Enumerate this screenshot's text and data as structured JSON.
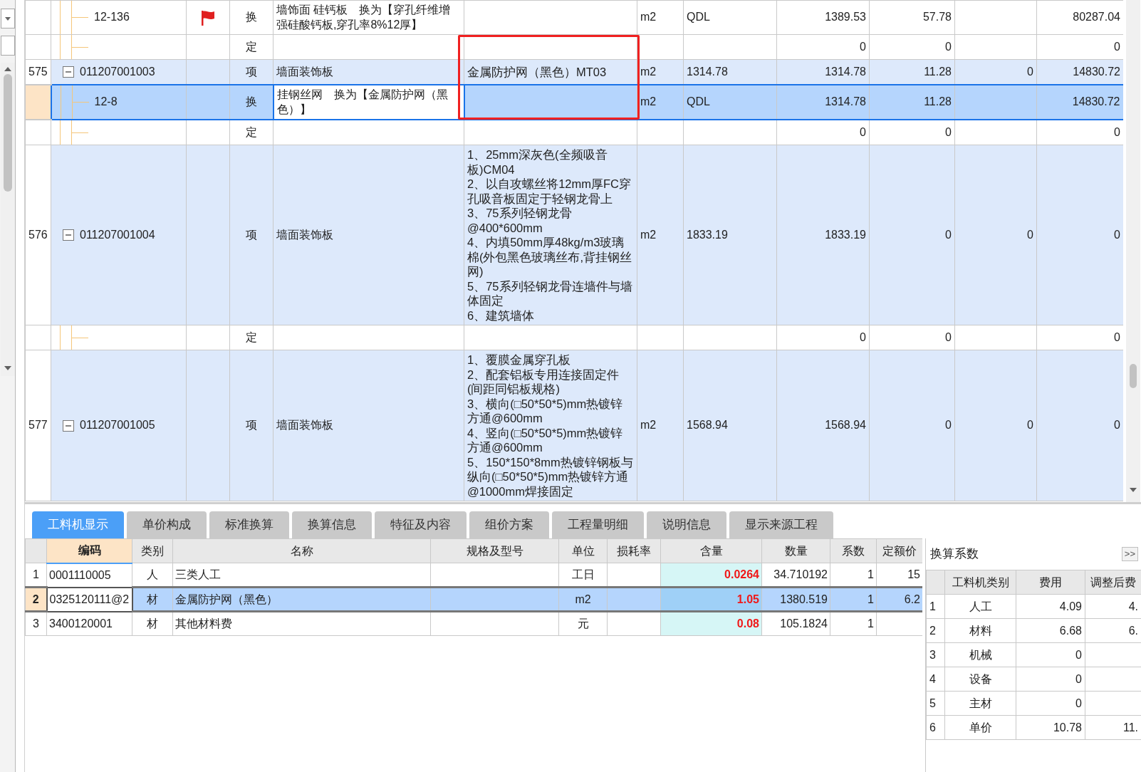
{
  "grid": {
    "rows": [
      {
        "kind": "sub",
        "number": "",
        "code": "12-136",
        "flagged": true,
        "type": "换",
        "name": "墙饰面 硅钙板　换为【穿孔纤维增强硅酸钙板,穿孔率8%12厚】",
        "unit": "m2",
        "expression": "QDL",
        "quantity": "1389.53",
        "price": "57.78",
        "total": "80287.04",
        "selected": false,
        "marked": false
      },
      {
        "kind": "sub",
        "number": "",
        "flagged": false,
        "type": "定",
        "quantity": "0",
        "price": "0",
        "total": "0",
        "selected": false,
        "marked": true
      },
      {
        "kind": "item",
        "number": "575",
        "code": "011207001003",
        "expanded": true,
        "flagged": false,
        "type": "项",
        "name": "墙面装饰板",
        "spec": [
          "金属防护网（黑色）MT03"
        ],
        "unit": "m2",
        "expression": "1314.78",
        "quantity": "1314.78",
        "price": "11.28",
        "column_11": "0",
        "total": "14830.72",
        "selected": false,
        "marked": true
      },
      {
        "kind": "sub",
        "number": "",
        "code": "12-8",
        "flagged": false,
        "type": "换",
        "name": "挂钢丝网　换为【金属防护网（黑色）】",
        "unit": "m2",
        "expression": "QDL",
        "quantity": "1314.78",
        "price": "11.28",
        "total": "14830.72",
        "selected": true,
        "marked": true
      },
      {
        "kind": "sub",
        "number": "",
        "flagged": false,
        "type": "定",
        "quantity": "0",
        "price": "0",
        "total": "0",
        "selected": false,
        "marked": false
      },
      {
        "kind": "item",
        "number": "576",
        "code": "011207001004",
        "expanded": true,
        "flagged": false,
        "type": "项",
        "name": "墙面装饰板",
        "spec": [
          "1、25mm深灰色(全频吸音板)CM04",
          "2、以自攻螺丝将12mm厚FC穿孔吸音板固定于轻钢龙骨上",
          "3、75系列轻钢龙骨@400*600mm",
          "4、内填50mm厚48kg/m3玻璃棉(外包黑色玻璃丝布,背挂钢丝网)",
          "5、75系列轻钢龙骨连墙件与墙体固定",
          "6、建筑墙体"
        ],
        "unit": "m2",
        "expression": "1833.19",
        "quantity": "1833.19",
        "price": "0",
        "column_11": "0",
        "total": "0",
        "selected": false,
        "marked": false
      },
      {
        "kind": "sub",
        "number": "",
        "flagged": false,
        "type": "定",
        "quantity": "0",
        "price": "0",
        "total": "0",
        "selected": false,
        "marked": false
      },
      {
        "kind": "item",
        "number": "577",
        "code": "011207001005",
        "expanded": true,
        "flagged": false,
        "type": "项",
        "name": "墙面装饰板",
        "spec": [
          "1、覆膜金属穿孔板",
          "2、配套铝板专用连接固定件(间距同铝板规格)",
          "3、横向(□50*50*5)mm热镀锌方通@600mm",
          "4、竖向(□50*50*5)mm热镀锌方通@600mm",
          "5、150*150*8mm热镀锌钢板与纵向(□50*50*5)mm热镀锌方通@1000mm焊接固定"
        ],
        "unit": "m2",
        "expression": "1568.94",
        "quantity": "1568.94",
        "price": "0",
        "column_11": "0",
        "total": "0",
        "selected": false,
        "marked": false
      }
    ]
  },
  "detail_tabs": [
    {
      "label": "工料机显示",
      "selected": true
    },
    {
      "label": "单价构成",
      "selected": false
    },
    {
      "label": "标准换算",
      "selected": false
    },
    {
      "label": "换算信息",
      "selected": false
    },
    {
      "label": "特征及内容",
      "selected": false
    },
    {
      "label": "组价方案",
      "selected": false
    },
    {
      "label": "工程量明细",
      "selected": false
    },
    {
      "label": "说明信息",
      "selected": false
    },
    {
      "label": "显示来源工程",
      "selected": false
    }
  ],
  "resource_table": {
    "columns": [
      {
        "label": "编码",
        "selected": true,
        "highlighted": false
      },
      {
        "label": "类别",
        "selected": false,
        "highlighted": false
      },
      {
        "label": "名称",
        "selected": false,
        "highlighted": false
      },
      {
        "label": "规格及型号",
        "selected": false,
        "highlighted": false
      },
      {
        "label": "单位",
        "selected": false,
        "highlighted": false
      },
      {
        "label": "损耗率",
        "selected": false,
        "highlighted": false
      },
      {
        "label": "含量",
        "selected": false,
        "highlighted": true
      },
      {
        "label": "数量",
        "selected": false,
        "highlighted": false
      },
      {
        "label": "系数",
        "selected": false,
        "highlighted": false
      },
      {
        "label": "定额价",
        "selected": false,
        "highlighted": false
      }
    ],
    "rows": [
      {
        "number": "1",
        "cells": [
          "0001110005",
          "人",
          "三类人工",
          null,
          "工日",
          null,
          "0.0264",
          "34.710192",
          "1",
          "15"
        ],
        "selected": false
      },
      {
        "number": "2",
        "cells": [
          "0325120111@2",
          "材",
          "金属防护网（黑色）",
          null,
          "m2",
          null,
          "1.05",
          "1380.519",
          "1",
          "6.2"
        ],
        "selected": true
      },
      {
        "number": "3",
        "cells": [
          "3400120001",
          "材",
          "其他材料费",
          null,
          "元",
          null,
          "0.08",
          "105.1824",
          "1",
          null
        ],
        "selected": false
      }
    ]
  },
  "conversion_panel": {
    "title": "换算系数",
    "expand_button": ">>",
    "columns": [
      "工料机类别",
      "费用",
      "调整后费"
    ],
    "rows": [
      {
        "number": "1",
        "category": "人工",
        "fee": "4.09",
        "adjusted": "4."
      },
      {
        "number": "2",
        "category": "材料",
        "fee": "6.68",
        "adjusted": "6."
      },
      {
        "number": "3",
        "category": "机械",
        "fee": "0"
      },
      {
        "number": "4",
        "category": "设备",
        "fee": "0"
      },
      {
        "number": "5",
        "category": "主材",
        "fee": "0"
      },
      {
        "number": "6",
        "category": "单价",
        "fee": "10.78",
        "adjusted": "11."
      }
    ]
  }
}
